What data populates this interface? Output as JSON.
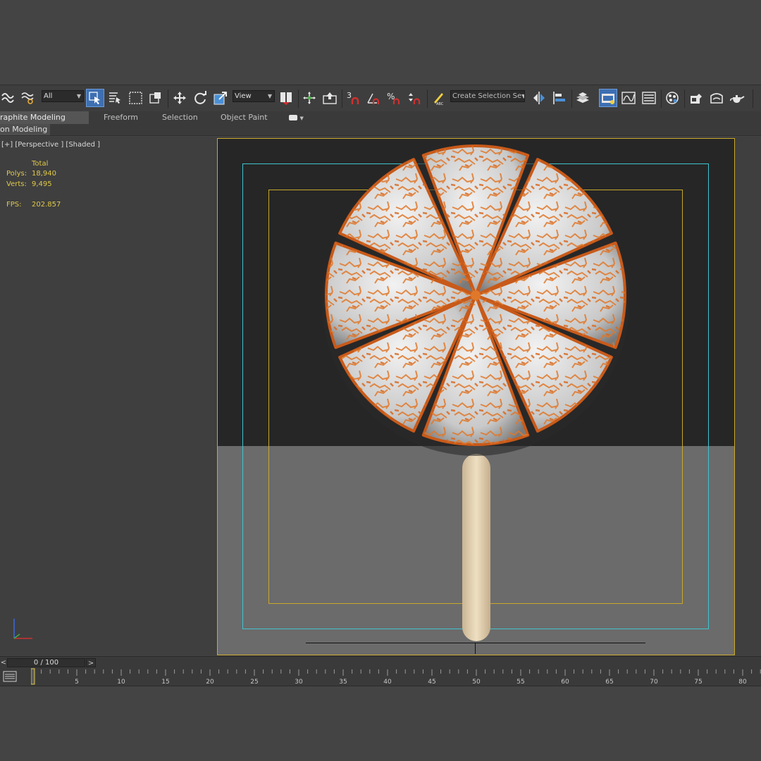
{
  "toolbar": {
    "selection_filter": "All",
    "ref_coord_system": "View",
    "named_selection_placeholder": "Create Selection Se",
    "snap_label": "3",
    "angle_snap_label": "",
    "percent_snap_label": "%",
    "active_color": "#3d6fb3"
  },
  "ribbon": {
    "tabs": [
      {
        "label": "raphite Modeling Tools",
        "active": true
      },
      {
        "label": "Freeform",
        "active": false
      },
      {
        "label": "Selection",
        "active": false
      },
      {
        "label": "Object Paint",
        "active": false
      }
    ],
    "sub_tab": "on Modeling"
  },
  "viewport": {
    "label": "[+] [Perspective ] [Shaded ]",
    "stats": {
      "total_label": "Total",
      "polys_label": "Polys:",
      "polys_value": "18,940",
      "verts_label": "Verts:",
      "verts_value": "9,495",
      "fps_label": "FPS:",
      "fps_value": "202.857"
    },
    "frame_color": "#c8a82a",
    "safe_color": "#3fc4cf"
  },
  "timeline": {
    "left_arrow": "<",
    "frame_display": "0 / 100",
    "right_arrow": ">",
    "tick_labels": [
      "5",
      "10",
      "15",
      "20",
      "25",
      "30",
      "35",
      "40",
      "45",
      "50",
      "55",
      "60",
      "65",
      "70",
      "75",
      "80"
    ]
  }
}
